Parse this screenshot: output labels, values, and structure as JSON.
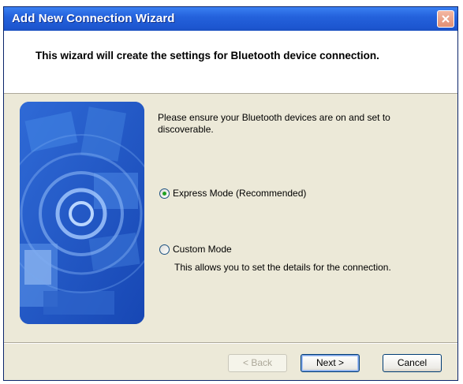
{
  "window": {
    "title": "Add New Connection Wizard"
  },
  "header": {
    "text": "This wizard will create the settings for Bluetooth device connection."
  },
  "content": {
    "intro": "Please ensure your Bluetooth devices are on and set to discoverable.",
    "options": [
      {
        "label": "Express Mode (Recommended)",
        "selected": true
      },
      {
        "label": "Custom Mode",
        "selected": false,
        "description": "This allows you to set the details for the connection."
      }
    ]
  },
  "buttons": {
    "back": "< Back",
    "next": "Next >",
    "cancel": "Cancel"
  },
  "icons": {
    "close": "close-icon",
    "side_image": "bluetooth-devices-illustration"
  },
  "colors": {
    "titlebar": "#2462dc",
    "dialog_background": "#ece9d8",
    "illustration_blue": "#1e56c8",
    "close_button": "#e08f74"
  }
}
